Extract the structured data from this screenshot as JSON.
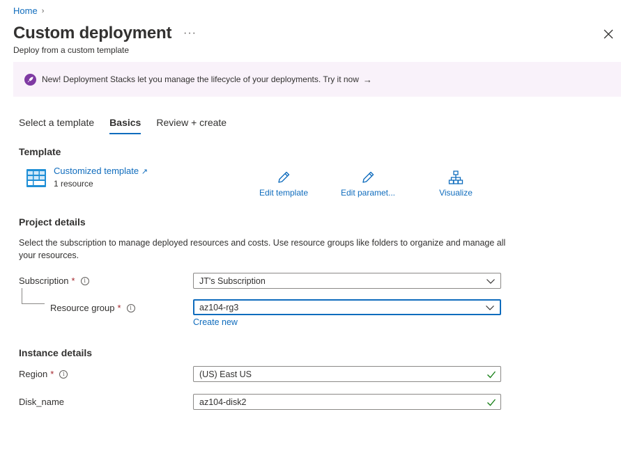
{
  "breadcrumb": {
    "home": "Home",
    "separator": "›"
  },
  "header": {
    "title": "Custom deployment",
    "more": "···",
    "subtitle": "Deploy from a custom template"
  },
  "banner": {
    "text": "New! Deployment Stacks let you manage the lifecycle of your deployments. Try it now",
    "arrow": "→"
  },
  "tabs": [
    {
      "label": "Select a template",
      "active": false
    },
    {
      "label": "Basics",
      "active": true
    },
    {
      "label": "Review + create",
      "active": false
    }
  ],
  "template": {
    "heading": "Template",
    "name": "Customized template",
    "external_icon": "↗",
    "resources": "1 resource",
    "actions": [
      {
        "label": "Edit template",
        "icon": "pencil-icon"
      },
      {
        "label": "Edit paramet...",
        "icon": "pencil-icon"
      },
      {
        "label": "Visualize",
        "icon": "hierarchy-icon"
      }
    ]
  },
  "project": {
    "heading": "Project details",
    "description": "Select the subscription to manage deployed resources and costs. Use resource groups like folders to organize and manage all your resources.",
    "subscription": {
      "label": "Subscription",
      "required": "*",
      "info": "i",
      "value": "JT's Subscription"
    },
    "resource_group": {
      "label": "Resource group",
      "required": "*",
      "info": "i",
      "value": "az104-rg3",
      "create_new": "Create new"
    }
  },
  "instance": {
    "heading": "Instance details",
    "region": {
      "label": "Region",
      "required": "*",
      "info": "i",
      "value": "(US) East US"
    },
    "disk_name": {
      "label": "Disk_name",
      "value": "az104-disk2"
    }
  },
  "colors": {
    "accent": "#0f6cbd",
    "banner_bg": "#f9f2fa",
    "rocket": "#7f3aa3",
    "required": "#a4262c",
    "valid": "#107c10"
  }
}
